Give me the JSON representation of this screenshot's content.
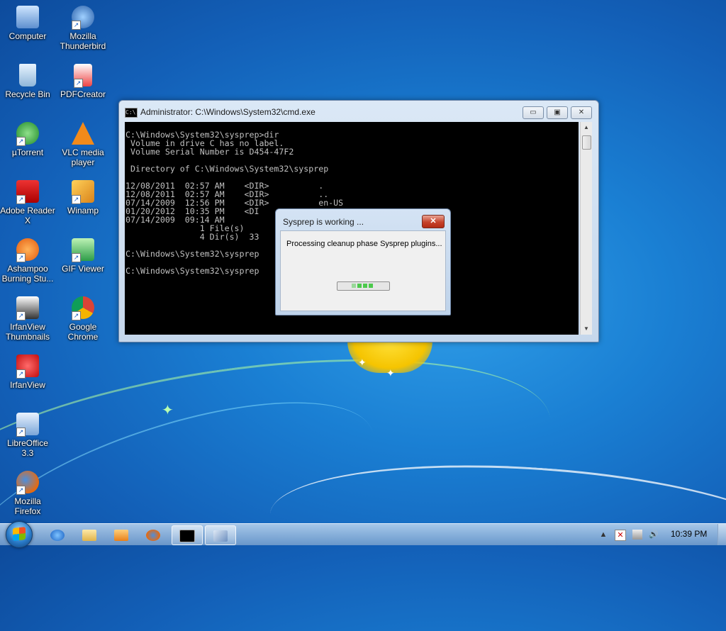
{
  "desktop": {
    "icons": [
      {
        "label": "Computer"
      },
      {
        "label": "Mozilla\nThunderbird"
      },
      {
        "label": "Recycle Bin"
      },
      {
        "label": "PDFCreator"
      },
      {
        "label": "µTorrent"
      },
      {
        "label": "VLC media\nplayer"
      },
      {
        "label": "Adobe Reader\nX"
      },
      {
        "label": "Winamp"
      },
      {
        "label": "Ashampoo\nBurning Stu..."
      },
      {
        "label": "GIF Viewer"
      },
      {
        "label": "IrfanView\nThumbnails"
      },
      {
        "label": "Google\nChrome"
      },
      {
        "label": "IrfanView"
      },
      {
        "label": "LibreOffice\n3.3"
      },
      {
        "label": "Mozilla\nFirefox"
      }
    ]
  },
  "cmd_window": {
    "title": "Administrator: C:\\Windows\\System32\\cmd.exe",
    "icon_text": "C:\\.",
    "minimize": "▭",
    "restore": "▣",
    "close": "✕",
    "console_text": "C:\\Windows\\System32\\sysprep>dir\n Volume in drive C has no label.\n Volume Serial Number is D454-47F2\n\n Directory of C:\\Windows\\System32\\sysprep\n\n12/08/2011  02:57 AM    <DIR>          .\n12/08/2011  02:57 AM    <DIR>          ..\n07/14/2009  12:56 PM    <DIR>          en-US\n01/20/2012  10:35 PM    <DI\n07/14/2009  09:14 AM\n               1 File(s)\n               4 Dir(s)  33\n\nC:\\Windows\\System32\\sysprep                          eboot\n\nC:\\Windows\\System32\\sysprep"
  },
  "sysprep_dialog": {
    "title": "Sysprep is working ...",
    "close": "✕",
    "message": "Processing cleanup phase Sysprep plugins...",
    "progress_segments": 4
  },
  "taskbar": {
    "clock": "10:39 PM",
    "tray_up_arrow": "▲",
    "pinned": [
      {
        "name": "internet-explorer"
      },
      {
        "name": "windows-explorer"
      },
      {
        "name": "media-player"
      },
      {
        "name": "firefox"
      },
      {
        "name": "cmd"
      },
      {
        "name": "sysprep"
      }
    ]
  }
}
